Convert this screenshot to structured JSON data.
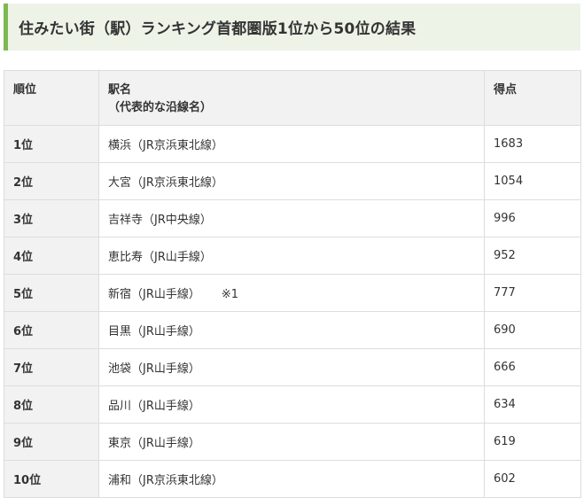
{
  "heading": {
    "title": "住みたい街（駅）ランキング首都圏版1位から50位の結果"
  },
  "table": {
    "headers": {
      "rank": "順位",
      "station": "駅名",
      "station_sub": "（代表的な沿線名）",
      "score": "得点"
    },
    "rows": [
      {
        "rank": "1位",
        "station": "横浜（JR京浜東北線）",
        "note": "",
        "score": "1683"
      },
      {
        "rank": "2位",
        "station": "大宮（JR京浜東北線）",
        "note": "",
        "score": "1054"
      },
      {
        "rank": "3位",
        "station": "吉祥寺（JR中央線）",
        "note": "",
        "score": "996"
      },
      {
        "rank": "4位",
        "station": "恵比寿（JR山手線）",
        "note": "",
        "score": "952"
      },
      {
        "rank": "5位",
        "station": "新宿（JR山手線）",
        "note": "※1",
        "score": "777"
      },
      {
        "rank": "6位",
        "station": "目黒（JR山手線）",
        "note": "",
        "score": "690"
      },
      {
        "rank": "7位",
        "station": "池袋（JR山手線）",
        "note": "",
        "score": "666"
      },
      {
        "rank": "8位",
        "station": "品川（JR山手線）",
        "note": "",
        "score": "634"
      },
      {
        "rank": "9位",
        "station": "東京（JR山手線）",
        "note": "",
        "score": "619"
      },
      {
        "rank": "10位",
        "station": "浦和（JR京浜東北線）",
        "note": "",
        "score": "602"
      }
    ]
  }
}
